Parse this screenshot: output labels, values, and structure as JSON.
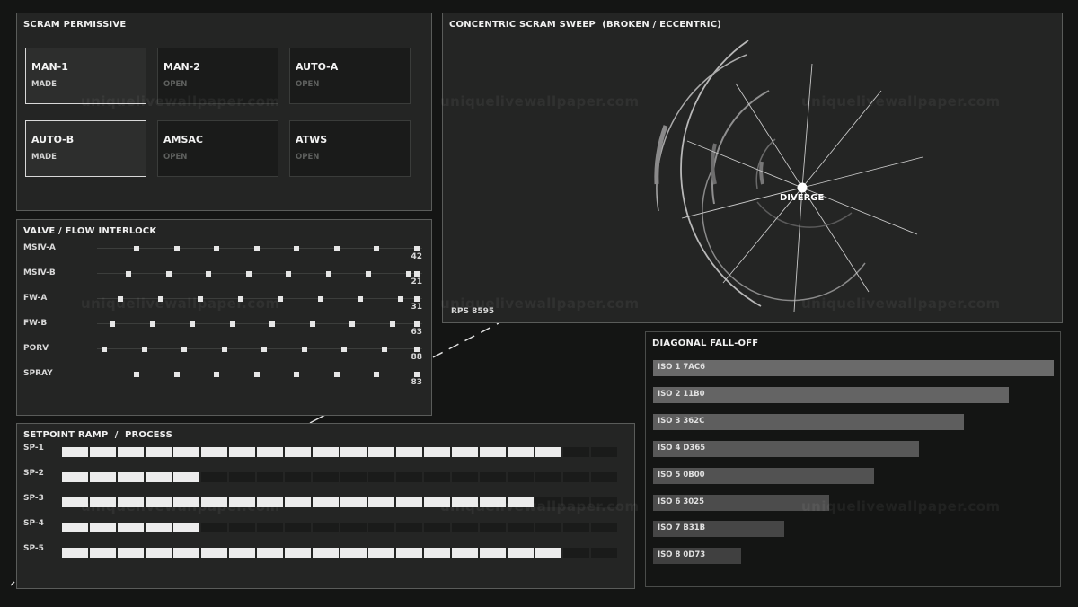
{
  "scram": {
    "title": "SCRAM PERMISSIVE",
    "tiles": [
      {
        "name": "MAN-1",
        "state": "MADE"
      },
      {
        "name": "MAN-2",
        "state": "OPEN"
      },
      {
        "name": "AUTO-A",
        "state": "OPEN"
      },
      {
        "name": "AUTO-B",
        "state": "MADE"
      },
      {
        "name": "AMSAC",
        "state": "OPEN"
      },
      {
        "name": "ATWS",
        "state": "OPEN"
      }
    ]
  },
  "valve": {
    "title": "VALVE / FLOW INTERLOCK",
    "rows": [
      {
        "label": "MSIV-A",
        "value": "42"
      },
      {
        "label": "MSIV-B",
        "value": "21"
      },
      {
        "label": "FW-A",
        "value": "31"
      },
      {
        "label": "FW-B",
        "value": "63"
      },
      {
        "label": "PORV",
        "value": "88"
      },
      {
        "label": "SPRAY",
        "value": "83"
      }
    ]
  },
  "setpoint": {
    "title": "SETPOINT RAMP  /  PROCESS",
    "total_segments": 20,
    "rows": [
      {
        "label": "SP-1",
        "lit": 18
      },
      {
        "label": "SP-2",
        "lit": 5
      },
      {
        "label": "SP-3",
        "lit": 17
      },
      {
        "label": "SP-4",
        "lit": 5
      },
      {
        "label": "SP-5",
        "lit": 18
      }
    ]
  },
  "sweep": {
    "title": "CONCENTRIC SCRAM SWEEP  (BROKEN / ECCENTRIC)",
    "center_label": "DIVERGE",
    "readout": "RPS 8595"
  },
  "diagonal": {
    "title": "DIAGONAL FALL-OFF",
    "bars": [
      {
        "label": "ISO 1  7AC6",
        "level": 1.0
      },
      {
        "label": "ISO 2  11B0",
        "level": 0.888
      },
      {
        "label": "ISO 3  362C",
        "level": 0.776
      },
      {
        "label": "ISO 4  D365",
        "level": 0.664
      },
      {
        "label": "ISO 5  0B00",
        "level": 0.552
      },
      {
        "label": "ISO 6  3025",
        "level": 0.44
      },
      {
        "label": "ISO 7  B31B",
        "level": 0.328
      },
      {
        "label": "ISO 8  0D73",
        "level": 0.22
      }
    ]
  },
  "watermark": "uniquelivewallpaper.com",
  "colors": {
    "background": "#141514",
    "panel": "#242524",
    "accent": "#ececec"
  }
}
